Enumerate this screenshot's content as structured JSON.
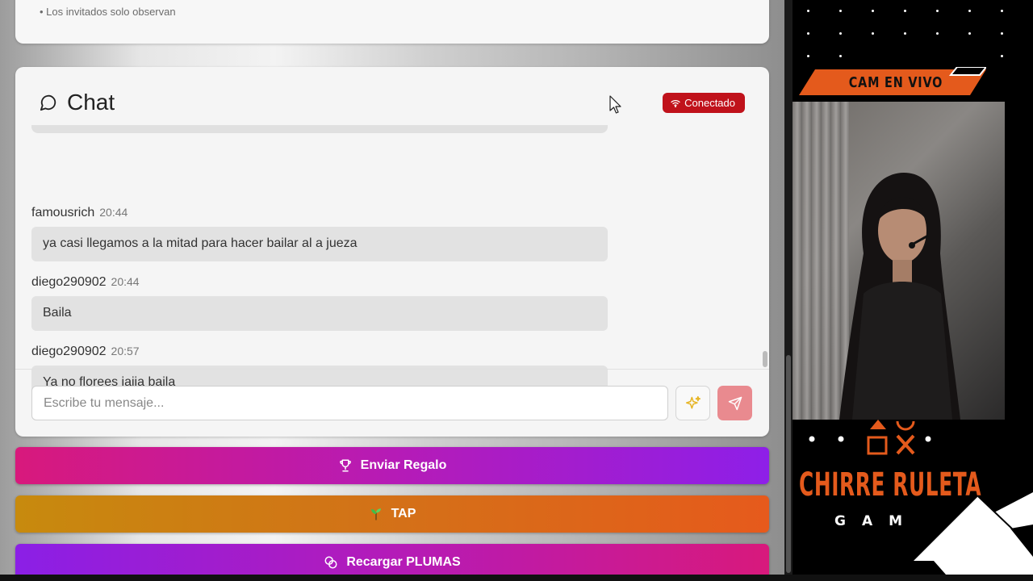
{
  "top_card": {
    "note": "• Los invitados solo observan"
  },
  "chat": {
    "title": "Chat",
    "status": "Conectado",
    "messages": [
      {
        "user": "famousrich",
        "time": "20:44",
        "text": "ya casi llegamos a la mitad para hacer bailar al a jueza"
      },
      {
        "user": "diego290902",
        "time": "20:44",
        "text": "Baila"
      },
      {
        "user": "diego290902",
        "time": "20:57",
        "text": "Ya no florees jajja baila"
      }
    ],
    "input_placeholder": "Escribe tu mensaje..."
  },
  "actions": {
    "gift_label": "Enviar Regalo",
    "tap_label": "TAP",
    "recharge_label": "Recargar PLUMAS"
  },
  "overlay": {
    "cam_label": "CAM EN VIVO",
    "brand_title": "CHIRRE RULETA",
    "brand_sub": "GAM"
  },
  "colors": {
    "status_red": "#c0121b",
    "send_button": "#e98a8f",
    "brand_orange": "#e45a1c"
  },
  "icons": {
    "chat": "speech-bubble-icon",
    "status": "wifi-icon",
    "sparkle": "sparkle-icon",
    "send": "send-icon",
    "gift": "trophy-icon",
    "tap": "plant-icon",
    "recharge": "coins-icon"
  }
}
